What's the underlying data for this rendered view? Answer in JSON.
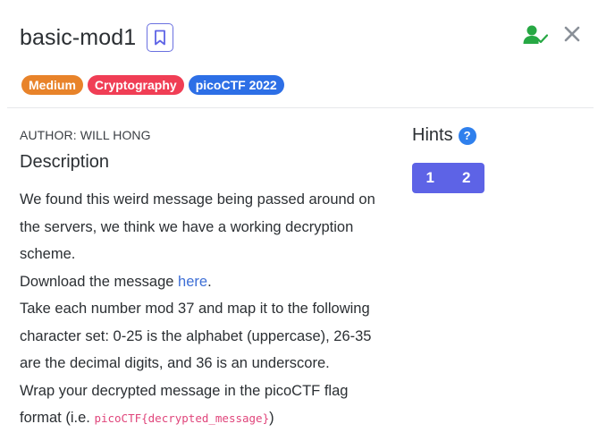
{
  "header": {
    "title": "basic-mod1"
  },
  "tags": [
    {
      "label": "Medium",
      "color": "#e8832a"
    },
    {
      "label": "Cryptography",
      "color": "#f03e55"
    },
    {
      "label": "picoCTF 2022",
      "color": "#2d6fe6"
    }
  ],
  "author": "AUTHOR: WILL HONG",
  "description": {
    "heading": "Description",
    "line1": "We found this weird message being passed around on the servers, we think we have a working decryption scheme.",
    "download_prefix": "Download the message ",
    "download_link": "here",
    "download_suffix": ".",
    "line3": "Take each number mod 37 and map it to the following character set: 0-25 is the alphabet (uppercase), 26-35 are the decimal digits, and 36 is an underscore.",
    "line4_prefix": "Wrap your decrypted message in the picoCTF flag format (i.e. ",
    "line4_code": "picoCTF{decrypted_message}",
    "line4_suffix": ")"
  },
  "hints": {
    "title": "Hints",
    "help_glyph": "?",
    "buttons": [
      "1",
      "2"
    ]
  },
  "colors": {
    "accent": "#5d63e6",
    "solved": "#27a844",
    "link": "#3e6fd6",
    "code": "#e0457b"
  },
  "icons": [
    "bookmark-icon",
    "user-check-icon",
    "close-icon",
    "help-icon"
  ]
}
